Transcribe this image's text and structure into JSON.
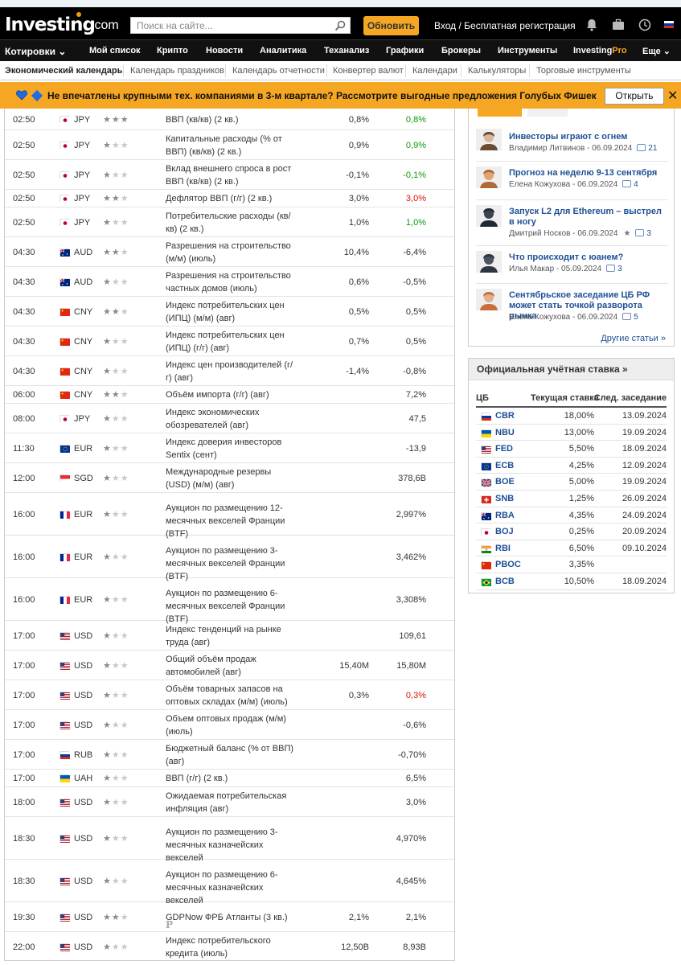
{
  "header": {
    "logo": "Investing",
    "logo_suffix": ".com",
    "search_placeholder": "Поиск на сайте...",
    "upgrade_label": "Обновить",
    "login_label": "Вход / Бесплатная регистрация"
  },
  "main_nav": [
    {
      "label": "Котировки ⌄"
    },
    {
      "label": "Мой список"
    },
    {
      "label": "Крипто"
    },
    {
      "label": "Новости"
    },
    {
      "label": "Аналитика"
    },
    {
      "label": "Теханализ"
    },
    {
      "label": "Графики"
    },
    {
      "label": "Брокеры"
    },
    {
      "label": "Инструменты"
    },
    {
      "label": "Investing",
      "pro": "Pro"
    },
    {
      "label": "Еще ⌄"
    }
  ],
  "sub_nav": [
    {
      "label": "Экономический календарь"
    },
    {
      "label": "Календарь праздников"
    },
    {
      "label": "Календарь отчетности"
    },
    {
      "label": "Конвертер валют"
    },
    {
      "label": "Календари"
    },
    {
      "label": "Калькуляторы"
    },
    {
      "label": "Торговые инструменты"
    }
  ],
  "promo": {
    "text": "Не впечатлены крупными тех. компаниями в 3-м квартале? Рассмотрите выгодные предложения Голубых Фишек",
    "button_label": "Открыть"
  },
  "calendar_rows": [
    {
      "time": "02:50",
      "flag": "jp",
      "currency": "JPY",
      "importance": 3,
      "event": "ВВП (кв/кв) (2 кв.)",
      "actual": "0,8%",
      "previous": "0,8%",
      "prev_color": "green"
    },
    {
      "time": "02:50",
      "flag": "jp",
      "currency": "JPY",
      "importance": 1,
      "event": "Капитальные расходы (% от ВВП) (кв/кв) (2 кв.)",
      "actual": "0,9%",
      "previous": "0,9%",
      "prev_color": "green"
    },
    {
      "time": "02:50",
      "flag": "jp",
      "currency": "JPY",
      "importance": 1,
      "event": "Вклад внешнего спроса в рост ВВП (кв/кв) (2 кв.)",
      "actual": "-0,1%",
      "previous": "-0,1%",
      "prev_color": "green"
    },
    {
      "time": "02:50",
      "flag": "jp",
      "currency": "JPY",
      "importance": 2,
      "event": "Дефлятор ВВП (г/г) (2 кв.)",
      "actual": "3,0%",
      "previous": "3,0%",
      "prev_color": "red"
    },
    {
      "time": "02:50",
      "flag": "jp",
      "currency": "JPY",
      "importance": 1,
      "event": "Потребительские расходы (кв/кв) (2 кв.)",
      "actual": "1,0%",
      "previous": "1,0%",
      "prev_color": "green"
    },
    {
      "time": "04:30",
      "flag": "au",
      "currency": "AUD",
      "importance": 2,
      "event": "Разрешения на строительство (м/м) (июль)",
      "actual": "10,4%",
      "previous": "-6,4%",
      "prev_color": "neutral"
    },
    {
      "time": "04:30",
      "flag": "au",
      "currency": "AUD",
      "importance": 1,
      "event": "Разрешения на строительство частных домов (июль)",
      "actual": "0,6%",
      "previous": "-0,5%",
      "prev_color": "neutral"
    },
    {
      "time": "04:30",
      "flag": "cn",
      "currency": "CNY",
      "importance": 2,
      "event": "Индекс потребительских цен (ИПЦ) (м/м) (авг)",
      "actual": "0,5%",
      "previous": "0,5%",
      "prev_color": "neutral"
    },
    {
      "time": "04:30",
      "flag": "cn",
      "currency": "CNY",
      "importance": 1,
      "event": "Индекс потребительских цен (ИПЦ) (г/г) (авг)",
      "actual": "0,7%",
      "previous": "0,5%",
      "prev_color": "neutral"
    },
    {
      "time": "04:30",
      "flag": "cn",
      "currency": "CNY",
      "importance": 1,
      "event": "Индекс цен производителей (г/г) (авг)",
      "actual": "-1,4%",
      "previous": "-0,8%",
      "prev_color": "neutral"
    },
    {
      "time": "06:00",
      "flag": "cn",
      "currency": "CNY",
      "importance": 2,
      "event": "Объём импорта (г/г) (авг)",
      "actual": "",
      "previous": "7,2%",
      "prev_color": "neutral"
    },
    {
      "time": "08:00",
      "flag": "jp",
      "currency": "JPY",
      "importance": 1,
      "event": "Индекс экономических обозревателей (авг)",
      "actual": "",
      "previous": "47,5",
      "prev_color": "neutral"
    },
    {
      "time": "11:30",
      "flag": "eu",
      "currency": "EUR",
      "importance": 1,
      "event": "Индекс доверия инвесторов Sentix (сент)",
      "actual": "",
      "previous": "-13,9",
      "prev_color": "neutral"
    },
    {
      "time": "12:00",
      "flag": "sg",
      "currency": "SGD",
      "importance": 1,
      "event": "Международные резервы (USD) (м/м) (авг)",
      "actual": "",
      "previous": "378,6B",
      "prev_color": "neutral"
    },
    {
      "time": "16:00",
      "flag": "fr",
      "currency": "EUR",
      "importance": 1,
      "event": "Аукцион по размещению 12-месячных векселей Франции (BTF)",
      "actual": "",
      "previous": "2,997%",
      "prev_color": "neutral"
    },
    {
      "time": "16:00",
      "flag": "fr",
      "currency": "EUR",
      "importance": 1,
      "event": "Аукцион по размещению 3-месячных векселей Франции (BTF)",
      "actual": "",
      "previous": "3,462%",
      "prev_color": "neutral"
    },
    {
      "time": "16:00",
      "flag": "fr",
      "currency": "EUR",
      "importance": 1,
      "event": "Аукцион по размещению 6-месячных векселей Франции (BTF)",
      "actual": "",
      "previous": "3,308%",
      "prev_color": "neutral"
    },
    {
      "time": "17:00",
      "flag": "us",
      "currency": "USD",
      "importance": 1,
      "event": "Индекс тенденций на рынке труда (авг)",
      "actual": "",
      "previous": "109,61",
      "prev_color": "neutral"
    },
    {
      "time": "17:00",
      "flag": "us",
      "currency": "USD",
      "importance": 1,
      "event": "Общий объём продаж автомобилей (авг)",
      "actual": "15,40M",
      "previous": "15,80M",
      "prev_color": "neutral"
    },
    {
      "time": "17:00",
      "flag": "us",
      "currency": "USD",
      "importance": 1,
      "event": "Объём товарных запасов на оптовых складах (м/м) (июль)",
      "actual": "0,3%",
      "previous": "0,3%",
      "prev_color": "red"
    },
    {
      "time": "17:00",
      "flag": "us",
      "currency": "USD",
      "importance": 1,
      "event": "Объем оптовых продаж (м/м) (июль)",
      "actual": "",
      "previous": "-0,6%",
      "prev_color": "neutral"
    },
    {
      "time": "17:00",
      "flag": "ru",
      "currency": "RUB",
      "importance": 1,
      "event": "Бюджетный баланс (% от ВВП) (авг)",
      "actual": "",
      "previous": "-0,70%",
      "prev_color": "neutral"
    },
    {
      "time": "17:00",
      "flag": "ua",
      "currency": "UAH",
      "importance": 1,
      "event": "ВВП (г/г) (2 кв.)",
      "actual": "",
      "previous": "6,5%",
      "prev_color": "neutral"
    },
    {
      "time": "18:00",
      "flag": "us",
      "currency": "USD",
      "importance": 1,
      "event": "Ожидаемая потребительская инфляция (авг)",
      "actual": "",
      "previous": "3,0%",
      "prev_color": "neutral"
    },
    {
      "time": "18:30",
      "flag": "us",
      "currency": "USD",
      "importance": 1,
      "event": "Аукцион по размещению 3-месячных казначейских векселей",
      "actual": "",
      "previous": "4,970%",
      "prev_color": "neutral"
    },
    {
      "time": "18:30",
      "flag": "us",
      "currency": "USD",
      "importance": 1,
      "event": "Аукцион по размещению 6-месячных казначейских векселей",
      "actual": "",
      "previous": "4,645%",
      "prev_color": "neutral"
    },
    {
      "time": "19:30",
      "flag": "us",
      "currency": "USD",
      "importance": 2,
      "event": "GDPNow ФРБ Атланты (3 кв.)",
      "actual": "2,1%",
      "previous": "2,1%",
      "prev_color": "neutral",
      "pre_liminary_icon": "P"
    },
    {
      "time": "22:00",
      "flag": "us",
      "currency": "USD",
      "importance": 1,
      "event": "Индекс потребительского кредита (июль)",
      "actual": "12,50B",
      "previous": "8,93B",
      "prev_color": "neutral"
    }
  ],
  "news": {
    "items": [
      {
        "title": "Инвесторы играют с огнем",
        "author": "Владимир Литвинов",
        "date": "06.09.2024",
        "comments": "21"
      },
      {
        "title": "Прогноз на неделю 9-13 сентября",
        "author": "Елена Кожухова",
        "date": "06.09.2024",
        "comments": "4"
      },
      {
        "title": "Запуск L2 для Ethereum – выстрел в ногу",
        "author": "Дмитрий Носков",
        "date": "06.09.2024",
        "comments": "3"
      },
      {
        "title": "Что происходит с юанем?",
        "author": "Илья Макар",
        "date": "05.09.2024",
        "comments": "3"
      },
      {
        "title": "Сентябрьское заседание ЦБ РФ может стать точкой разворота рынка",
        "author": "Елена Кожухова",
        "date": "06.09.2024",
        "comments": "5"
      }
    ],
    "more_label": "Другие статьи »"
  },
  "rates": {
    "title": "Официальная учётная ставка »",
    "col_bank": "ЦБ",
    "col_rate": "Текущая ставка",
    "col_next": "След. заседание",
    "rows": [
      {
        "bank": "CBR",
        "flag": "ru",
        "rate": "18,00%",
        "next": "13.09.2024"
      },
      {
        "bank": "NBU",
        "flag": "ua",
        "rate": "13,00%",
        "next": "19.09.2024"
      },
      {
        "bank": "FED",
        "flag": "us",
        "rate": "5,50%",
        "next": "18.09.2024"
      },
      {
        "bank": "ECB",
        "flag": "eu",
        "rate": "4,25%",
        "next": "12.09.2024"
      },
      {
        "bank": "BOE",
        "flag": "gb",
        "rate": "5,00%",
        "next": "19.09.2024"
      },
      {
        "bank": "SNB",
        "flag": "ch",
        "rate": "1,25%",
        "next": "26.09.2024"
      },
      {
        "bank": "RBA",
        "flag": "au",
        "rate": "4,35%",
        "next": "24.09.2024"
      },
      {
        "bank": "BOJ",
        "flag": "jp",
        "rate": "0,25%",
        "next": "20.09.2024"
      },
      {
        "bank": "RBI",
        "flag": "in",
        "rate": "6,50%",
        "next": "09.10.2024"
      },
      {
        "bank": "PBOC",
        "flag": "cn",
        "rate": "3,35%",
        "next": ""
      },
      {
        "bank": "BCB",
        "flag": "br",
        "rate": "10,50%",
        "next": "18.09.2024"
      }
    ]
  },
  "colors": {
    "accent": "#f5a623",
    "link": "#1e4f96",
    "positive": "#0a9b0a",
    "negative": "#d91400"
  }
}
